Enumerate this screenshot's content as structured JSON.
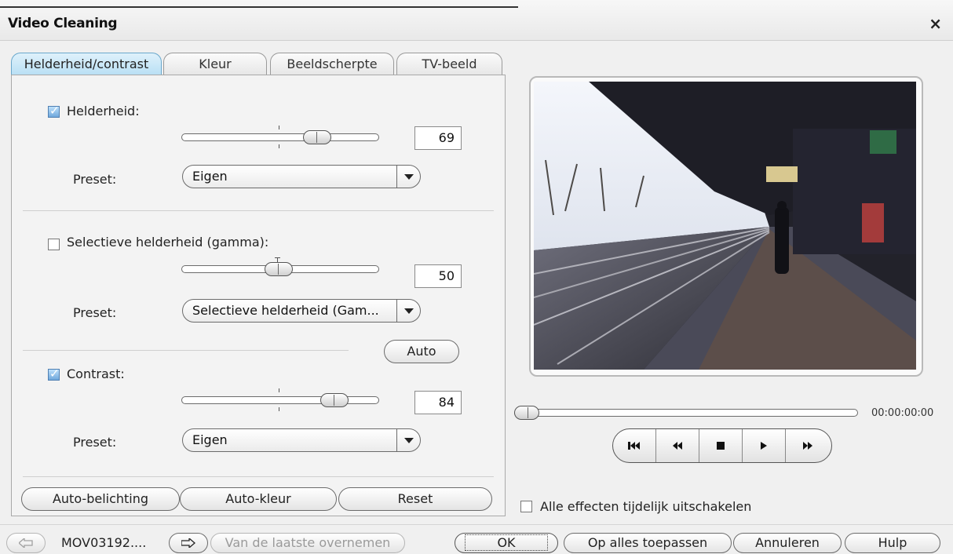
{
  "window": {
    "title": "Video Cleaning",
    "close_label": "×"
  },
  "tabs": [
    {
      "label": "Helderheid/contrast",
      "active": true
    },
    {
      "label": "Kleur",
      "active": false
    },
    {
      "label": "Beeldscherpte",
      "active": false
    },
    {
      "label": "TV-beeld",
      "active": false
    }
  ],
  "brightness": {
    "label": "Helderheid:",
    "checked": true,
    "value": "69",
    "preset_label": "Preset:",
    "preset_value": "Eigen"
  },
  "gamma": {
    "label": "Selectieve helderheid (gamma):",
    "checked": false,
    "value": "50",
    "preset_label": "Preset:",
    "preset_value": "Selectieve helderheid (Gam..."
  },
  "contrast": {
    "label": "Contrast:",
    "checked": true,
    "value": "84",
    "preset_label": "Preset:",
    "preset_value": "Eigen"
  },
  "auto_label": "Auto",
  "panel_buttons": {
    "auto_exposure": "Auto-belichting",
    "auto_color": "Auto-kleur",
    "reset": "Reset"
  },
  "player": {
    "timecode": "00:00:00:00",
    "position": 0
  },
  "disable_all_effects": {
    "label": "Alle effecten tijdelijk uitschakelen",
    "checked": false
  },
  "footer": {
    "filename": "MOV03192....",
    "copy_previous": "Van de laatste overnemen",
    "ok": "OK",
    "apply_all": "Op alles toepassen",
    "cancel": "Annuleren",
    "help": "Hulp"
  },
  "colors": {
    "tab_active": "#b8dff4",
    "checkbox_checked": "#6fa8dc"
  }
}
